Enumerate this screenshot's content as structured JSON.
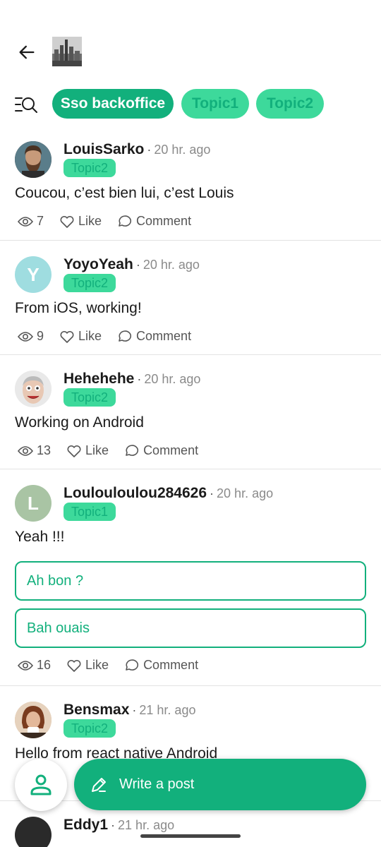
{
  "colors": {
    "accent": "#12b07c",
    "chip_inactive": "#3dd99b",
    "text": "#1a1a1a",
    "muted": "#8a8a8a"
  },
  "header": {
    "back_icon": "arrow-left-icon",
    "group_image": "city-skyline-thumbnail"
  },
  "filters": {
    "icon": "filter-search-icon",
    "chips": [
      {
        "label": "Sso backoffice",
        "active": true
      },
      {
        "label": "Topic1",
        "active": false
      },
      {
        "label": "Topic2",
        "active": false
      }
    ]
  },
  "posts": [
    {
      "author": "LouisSarko",
      "time": "20 hr. ago",
      "topic": "Topic2",
      "text": "Coucou, c’est bien lui, c’est Louis",
      "views": "7",
      "like": "Like",
      "comment": "Comment",
      "avatar": "photo-bearded-man"
    },
    {
      "author": "YoyoYeah",
      "time": "20 hr. ago",
      "topic": "Topic2",
      "text": "From iOS, working!",
      "views": "9",
      "like": "Like",
      "comment": "Comment",
      "avatar_letter": "Y",
      "avatar_color": "#9fdde0"
    },
    {
      "author": "Hehehehe",
      "time": "20 hr. ago",
      "topic": "Topic2",
      "text": "Working on Android",
      "views": "13",
      "like": "Like",
      "comment": "Comment",
      "avatar": "photo-funny-face"
    },
    {
      "author": "Loulouloulou284626",
      "time": "20 hr. ago",
      "topic": "Topic1",
      "text": "Yeah !!!",
      "poll_options": [
        "Ah bon ?",
        "Bah ouais"
      ],
      "views": "16",
      "like": "Like",
      "comment": "Comment",
      "avatar_letter": "L",
      "avatar_color": "#a9c4a4"
    },
    {
      "author": "Bensmax",
      "time": "21 hr. ago",
      "topic": "Topic2",
      "text": "Hello from react native Android",
      "avatar": "photo-woman-coffee"
    },
    {
      "author": "Eddy1",
      "time": "21 hr. ago"
    }
  ],
  "fab": {
    "profile_icon": "person-icon",
    "write_label": "Write a post",
    "write_icon": "pen-icon"
  }
}
